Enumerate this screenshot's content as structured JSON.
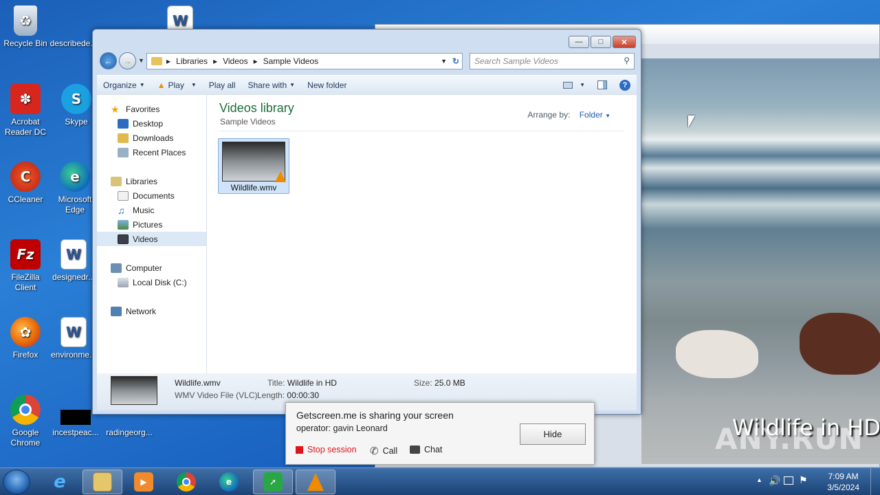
{
  "desktop": {
    "icons": [
      {
        "label": "Recycle Bin"
      },
      {
        "label": "describede..."
      },
      {
        "label": "Acrobat Reader DC"
      },
      {
        "label": "Skype"
      },
      {
        "label": "CCleaner"
      },
      {
        "label": "Microsoft Edge"
      },
      {
        "label": "FileZilla Client"
      },
      {
        "label": "designedr..."
      },
      {
        "label": "Firefox"
      },
      {
        "label": "environme..."
      },
      {
        "label": "Google Chrome"
      },
      {
        "label": "incestpeac..."
      },
      {
        "label": "radingeorg..."
      }
    ]
  },
  "video_window": {
    "caption": "Wildlife in HD"
  },
  "watermark": "ANY.RUN",
  "explorer": {
    "nav_path": [
      "Libraries",
      "Videos",
      "Sample Videos"
    ],
    "search_placeholder": "Search Sample Videos",
    "toolbar": {
      "organize": "Organize",
      "play": "Play",
      "play_all": "Play all",
      "share_with": "Share with",
      "new_folder": "New folder"
    },
    "nav_pane": {
      "favorites": "Favorites",
      "desktop": "Desktop",
      "downloads": "Downloads",
      "recent_places": "Recent Places",
      "libraries": "Libraries",
      "documents": "Documents",
      "music": "Music",
      "pictures": "Pictures",
      "videos": "Videos",
      "computer": "Computer",
      "local_disk": "Local Disk (C:)",
      "network": "Network"
    },
    "library_title": "Videos library",
    "library_subtitle": "Sample Videos",
    "arrange_by_label": "Arrange by:",
    "arrange_by_value": "Folder",
    "file": {
      "name": "Wildlife.wmv"
    },
    "details": {
      "name": "Wildlife.wmv",
      "type": "WMV Video File (VLC)",
      "title_label": "Title:",
      "title_value": "Wildlife in HD",
      "length_label": "Length:",
      "length_value": "00:00:30",
      "size_label": "Size:",
      "size_value": "25.0 MB"
    }
  },
  "getscreen": {
    "title": "Getscreen.me is sharing your screen",
    "operator": "operator: gavin Leonard",
    "hide": "Hide",
    "stop": "Stop session",
    "call": "Call",
    "chat": "Chat"
  },
  "taskbar": {
    "time": "7:09 AM",
    "date": "3/5/2024"
  },
  "colors": {
    "library_title": "#1e6b3a",
    "stop_red": "#e0141a",
    "desktop_blue": "#1b5fb8"
  }
}
